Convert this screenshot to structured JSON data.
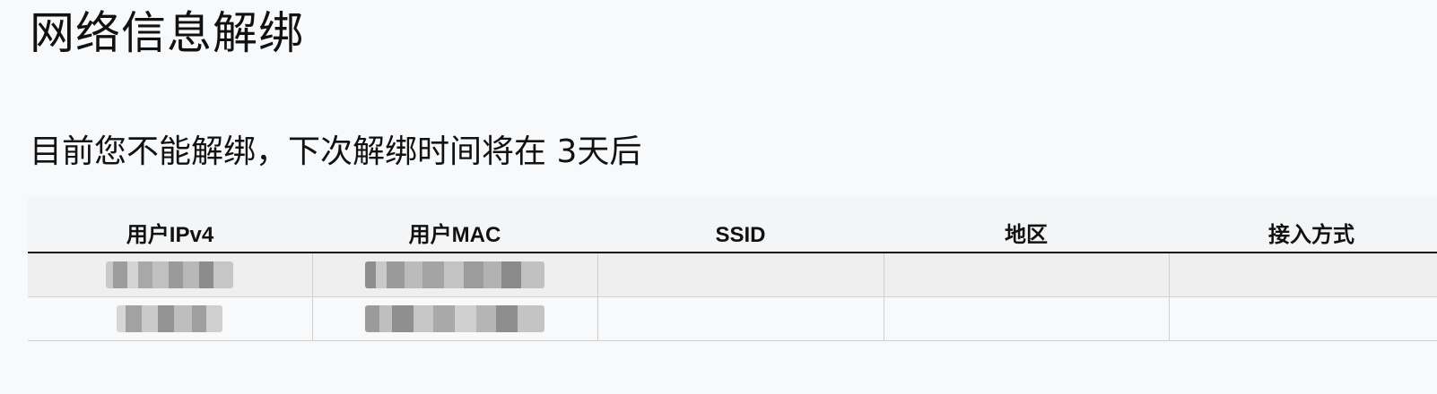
{
  "page": {
    "title": "网络信息解绑",
    "status_message": "目前您不能解绑，下次解绑时间将在 3天后"
  },
  "table": {
    "columns": [
      "用户IPv4",
      "用户MAC",
      "SSID",
      "地区",
      "接入方式"
    ],
    "rows": [
      {
        "ipv4": "",
        "mac": "",
        "ssid": "",
        "region": "",
        "access_method": ""
      },
      {
        "ipv4": "",
        "mac": "",
        "ssid": "",
        "region": "",
        "access_method": ""
      }
    ]
  }
}
